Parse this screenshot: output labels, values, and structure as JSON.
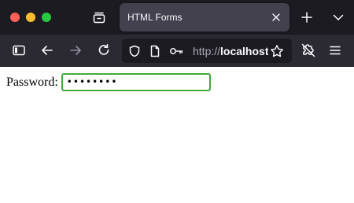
{
  "browser": {
    "tab": {
      "title": "HTML Forms"
    },
    "urlbar": {
      "scheme": "http://",
      "host": "localhost"
    },
    "icons": {
      "tabs_list": "tabs-list-icon",
      "tab_close": "close-icon",
      "new_tab": "plus-icon",
      "tab_menu": "chevron-down-icon",
      "sidebar": "sidebar-icon",
      "back": "arrow-left-icon",
      "forward": "arrow-right-icon",
      "reload": "reload-icon",
      "shield": "shield-icon",
      "page": "page-icon",
      "key": "key-icon",
      "bookmark": "star-icon",
      "extensions": "puzzle-icon",
      "menu": "hamburger-icon"
    },
    "colors": {
      "tabbar_bg": "#1c1b22",
      "toolbar_bg": "#2b2a33",
      "active_tab_bg": "#42414d",
      "focus_ring": "#3eaa3e"
    }
  },
  "page": {
    "form": {
      "password_label": "Password:",
      "password_value_masked": "••••••••"
    }
  }
}
